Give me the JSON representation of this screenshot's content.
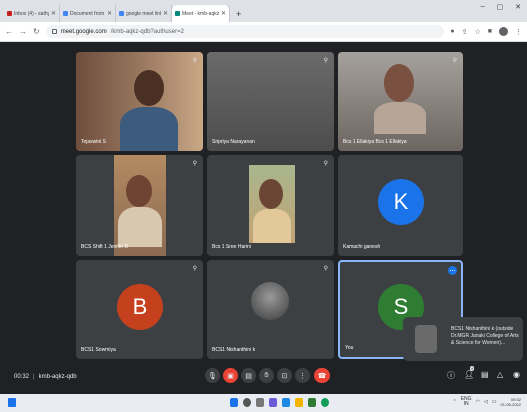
{
  "browser": {
    "tabs": [
      {
        "title": "Inbox (4) - sathyapriya7@SV9MIG",
        "icon": "gmail-icon",
        "active": false
      },
      {
        "title": "Document from Sathya💗 - Go",
        "icon": "doc-icon",
        "active": false
      },
      {
        "title": "google meet link - priyasathya",
        "icon": "google-icon",
        "active": false
      },
      {
        "title": "Meet - kmb-aqkz-qdb",
        "icon": "meet-icon",
        "active": true
      }
    ],
    "url_host": "meet.google.com",
    "url_path": "/kmb-aqkz-qdb?authuser=2"
  },
  "meeting": {
    "time": "00:32",
    "code": "kmb-aqkz-qdb"
  },
  "participants": [
    {
      "name": "Tejaswini S",
      "type": "video",
      "avatar_letter": "",
      "avatar_color": ""
    },
    {
      "name": "Sripriya Narayanan",
      "type": "video",
      "avatar_letter": "",
      "avatar_color": ""
    },
    {
      "name": "Bcs 1 Ellakiya Bcs 1 Ellakiya",
      "type": "video",
      "avatar_letter": "",
      "avatar_color": ""
    },
    {
      "name": "BCS Shift 1 Jenifer D",
      "type": "video",
      "avatar_letter": "",
      "avatar_color": ""
    },
    {
      "name": "Bcs 1 Sree Harini",
      "type": "video",
      "avatar_letter": "",
      "avatar_color": ""
    },
    {
      "name": "Kamachi ganesh",
      "type": "avatar",
      "avatar_letter": "K",
      "avatar_color": "#1a73e8"
    },
    {
      "name": "BCS1 Sowmiya",
      "type": "avatar",
      "avatar_letter": "B",
      "avatar_color": "#c5411e"
    },
    {
      "name": "BCS1 Nishanthini k",
      "type": "photo",
      "avatar_letter": "",
      "avatar_color": ""
    },
    {
      "name": "You",
      "type": "avatar",
      "avatar_letter": "S",
      "avatar_color": "#2e7d32"
    }
  ],
  "self_view": {
    "caption": "BCS1 Nishanthini k (outside Dr.MGR Janaki College of Arts & Science for Women)..."
  },
  "controls": {
    "left_buttons": [
      "mic-icon",
      "camera-off-icon",
      "captions-icon",
      "raise-hand-icon",
      "present-icon",
      "more-icon",
      "end-call-icon"
    ],
    "right_buttons": [
      "info-icon",
      "people-icon",
      "chat-icon",
      "activities-icon",
      "host-controls-icon"
    ],
    "people_badge": "9"
  },
  "taskbar": {
    "language": "ENG",
    "region": "IN",
    "time": "09:32",
    "date": "01-05-2022"
  },
  "colors": {
    "meet_bg": "#202124",
    "tile_bg": "#3c4043",
    "end_call": "#ea4335",
    "accent": "#8ab4f8"
  }
}
